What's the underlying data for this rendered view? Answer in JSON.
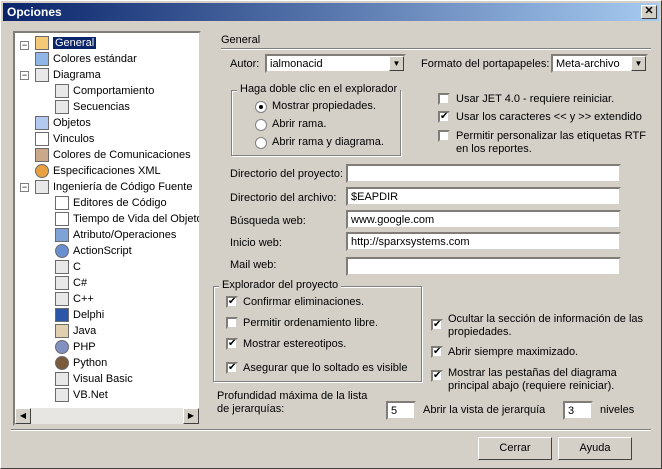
{
  "window": {
    "title": "Opciones",
    "close_label": "✕"
  },
  "tree": {
    "items": [
      {
        "label": "General",
        "selected": true
      },
      {
        "label": "Colores estándar"
      },
      {
        "label": "Diagrama"
      },
      {
        "label": "Comportamiento"
      },
      {
        "label": "Secuencias"
      },
      {
        "label": "Objetos"
      },
      {
        "label": "Vinculos"
      },
      {
        "label": "Colores de Comunicaciones"
      },
      {
        "label": "Especificaciones XML"
      },
      {
        "label": "Ingeniería de Código Fuente"
      },
      {
        "label": "Editores de Código"
      },
      {
        "label": "Tiempo de Vida del Objeto"
      },
      {
        "label": "Atributo/Operaciones"
      },
      {
        "label": "ActionScript"
      },
      {
        "label": "C"
      },
      {
        "label": "C#"
      },
      {
        "label": "C++"
      },
      {
        "label": "Delphi"
      },
      {
        "label": "Java"
      },
      {
        "label": "PHP"
      },
      {
        "label": "Python"
      },
      {
        "label": "Visual Basic"
      },
      {
        "label": "VB.Net"
      }
    ]
  },
  "general": {
    "section_title": "General",
    "author_label": "Autor:",
    "author_value": "ialmonacid",
    "clipboard_label": "Formato del portapapeles:",
    "clipboard_value": "Meta-archivo",
    "dblclick_group": "Haga doble clic en el explorador",
    "radio_show_props": "Mostrar propiedades.",
    "radio_open_branch": "Abrir rama.",
    "radio_open_branch_diagram": "Abrir rama y diagrama.",
    "chk_jet": "Usar JET 4.0 - requiere reiniciar.",
    "chk_chars": "Usar los caracteres << y >> extendido",
    "chk_rtf": "Permitir personalizar las etiquetas RTF en los reportes.",
    "project_dir_label": "Directorio del proyecto:",
    "project_dir_value": "",
    "file_dir_label": "Directorio del archivo:",
    "file_dir_value": "$EAPDIR",
    "web_search_label": "Búsqueda web:",
    "web_search_value": "www.google.com",
    "web_home_label": "Inicio web:",
    "web_home_value": "http://sparxsystems.com",
    "mail_label": "Mail web:",
    "mail_value": "",
    "explorer_group": "Explorador del proyecto",
    "chk_confirm_delete": "Confirmar eliminaciones.",
    "chk_free_sort": "Permitir ordenamiento libre.",
    "chk_stereotypes": "Mostrar estereotipos.",
    "chk_drop_visible": "Asegurar que lo soltado es visible",
    "chk_hide_info": "Ocultar la sección de información de las propiedades.",
    "chk_maximized": "Abrir siempre maximizado.",
    "chk_tabs_below": "Mostrar las pestañas del diagrama principal abajo (requiere reiniciar).",
    "depth_label": "Profundidad máxima de la lista de jerarquías:",
    "depth_value": "5",
    "open_hierarchy_label": "Abrir la vista de jerarquía",
    "open_hierarchy_value": "3",
    "levels_label": "niveles"
  },
  "buttons": {
    "close": "Cerrar",
    "help": "Ayuda"
  }
}
